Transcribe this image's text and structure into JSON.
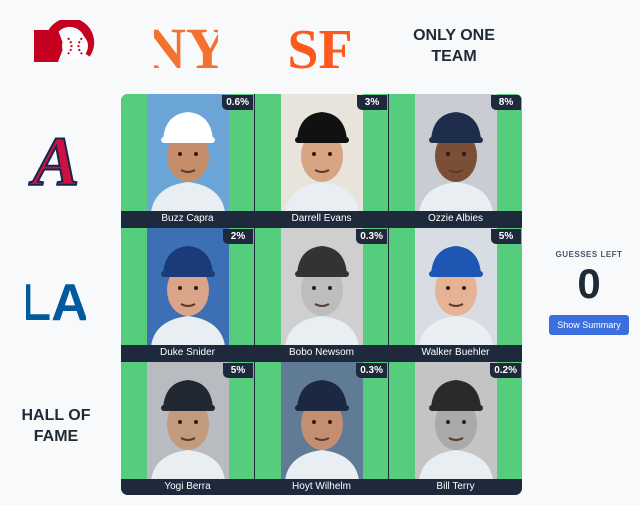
{
  "columns": [
    {
      "logo": "reds-logo",
      "color": "#c6011f"
    },
    {
      "logo": "mets-logo",
      "color": "#f4712f",
      "mark": "NY"
    },
    {
      "logo": "giants-logo",
      "color": "#fd5a1e",
      "mark": "SF"
    },
    {
      "text": "ONLY ONE\nTEAM"
    }
  ],
  "rows": [
    {
      "logo": "braves-logo",
      "color": "#ce1141",
      "mark": "A"
    },
    {
      "logo": "dodgers-logo",
      "color": "#005a9c",
      "mark": "LA"
    },
    {
      "text": "HALL OF\nFAME"
    }
  ],
  "cells": [
    {
      "name": "Buzz Capra",
      "percent": "0.6%",
      "bg": "#6ba4d6",
      "cap": "#ffffff",
      "skin": "#c48e6b"
    },
    {
      "name": "Darrell Evans",
      "percent": "3%",
      "bg": "#e8e4dc",
      "cap": "#111111",
      "skin": "#d7a582"
    },
    {
      "name": "Ozzie Albies",
      "percent": "8%",
      "bg": "#c9cdd3",
      "cap": "#1f2d4d",
      "skin": "#7a4f36"
    },
    {
      "name": "Duke Snider",
      "percent": "2%",
      "bg": "#3d6fb5",
      "cap": "#1a3a7a",
      "skin": "#d9a488"
    },
    {
      "name": "Bobo Newsom",
      "percent": "0.3%",
      "bg": "#cfcfcf",
      "cap": "#333333",
      "skin": "#bdbdbd"
    },
    {
      "name": "Walker Buehler",
      "percent": "5%",
      "bg": "#d8dde3",
      "cap": "#1d56b3",
      "skin": "#e6b395"
    },
    {
      "name": "Yogi Berra",
      "percent": "5%",
      "bg": "#b8bcc0",
      "cap": "#222831",
      "skin": "#c49a7c"
    },
    {
      "name": "Hoyt Wilhelm",
      "percent": "0.3%",
      "bg": "#5f7b96",
      "cap": "#1c2741",
      "skin": "#c38f70"
    },
    {
      "name": "Bill Terry",
      "percent": "0.2%",
      "bg": "#c4c4c4",
      "cap": "#2a2a2a",
      "skin": "#a9a9a9"
    }
  ],
  "guesses": {
    "label": "GUESSES LEFT",
    "count": "0"
  },
  "summary_button": "Show Summary"
}
